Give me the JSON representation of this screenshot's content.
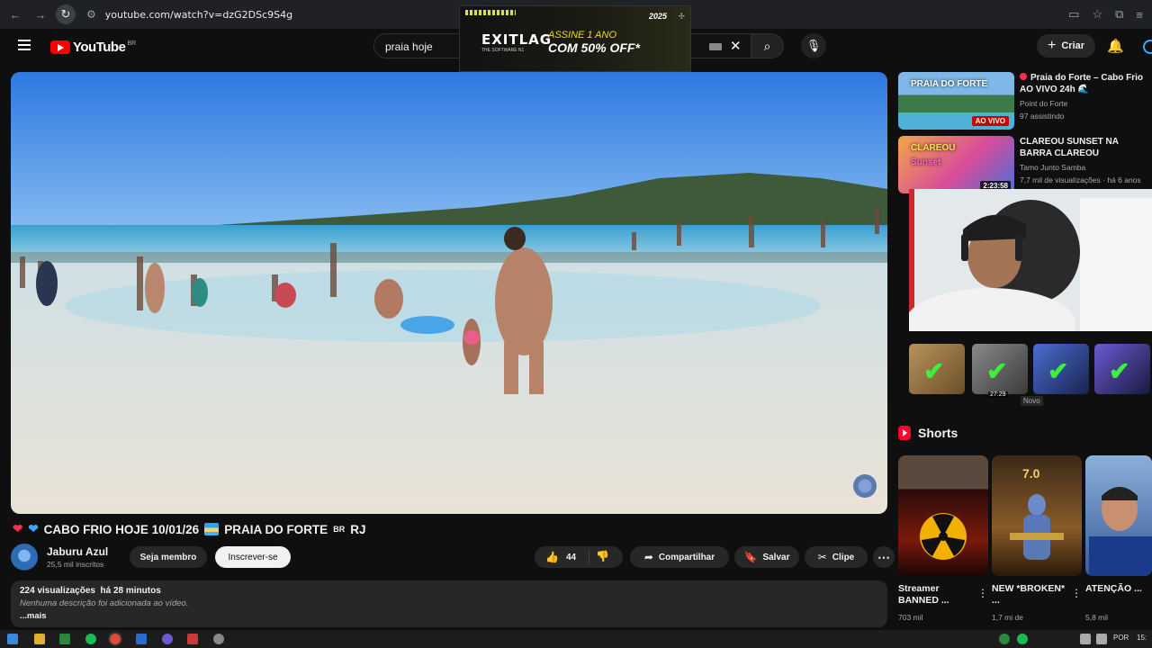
{
  "browser": {
    "url": "youtube.com/watch?v=dzG2DSc9S4g"
  },
  "ad": {
    "brand": "EXITLAG",
    "brand_sub": "THE SOFTWARE N1",
    "line1": "ASSINE 1 ANO",
    "line2": "COM 50% OFF*",
    "tag": "2025"
  },
  "header": {
    "logo": "YouTube",
    "country": "BR",
    "search_value": "praia hoje",
    "create_label": "Criar"
  },
  "video": {
    "title": "CABO FRIO HOJE 10/01/26 🏝 PRAIA DO FORTE ʙʀ RJ",
    "title_main": "CABO FRIO HOJE 10/01/26",
    "title_tail": "PRAIA DO FORTE",
    "title_br": "BR",
    "title_end": "RJ",
    "channel": "Jaburu Azul",
    "subscribers": "25,5 mil inscritos",
    "member_label": "Seja membro",
    "subscribe_label": "Inscrever-se",
    "likes": "44",
    "share_label": "Compartilhar",
    "save_label": "Salvar",
    "clip_label": "Clipe",
    "views": "224 visualizações",
    "posted": "há 28 minutos",
    "description": "Nenhuma descrição foi adicionada ao vídeo.",
    "more": "...mais"
  },
  "recommendations": [
    {
      "title": "Praia do Forte – Cabo Frio AO VIVO 24h 🌊",
      "channel": "Point do Forte",
      "meta": "97 assistindo",
      "thumb_text": "PRAIA DO FORTE",
      "thumb_sub": "AO VIVO",
      "badge": "AO VIVO",
      "live": true
    },
    {
      "title": "CLAREOU SUNSET NA BARRA CLAREOU",
      "channel": "Tamo Junto Samba",
      "meta": "7,7 mil de visualizações · há 6 anos",
      "thumb_text": "CLAREOU",
      "thumb_sub": "Sunset",
      "badge": "2:23:58",
      "live": false
    }
  ],
  "overlay": {
    "duration": "27:29",
    "new_badge": "Novo"
  },
  "shorts": {
    "heading": "Shorts",
    "items": [
      {
        "title": "Streamer BANNED ...",
        "views": "703 mil",
        "overlay": ""
      },
      {
        "title": "NEW *BROKEN* ...",
        "views": "1,7 mi de",
        "overlay": "7.0"
      },
      {
        "title": "ATENÇÃO ...",
        "views": "5,8 mil",
        "overlay": ""
      }
    ]
  },
  "taskbar": {
    "lang": "POR",
    "time": "15:"
  }
}
